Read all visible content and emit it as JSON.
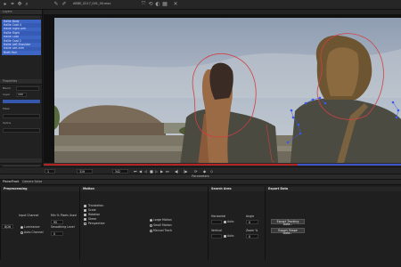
{
  "toolbar": {
    "title": "ABDE_0217_001_00.mov"
  },
  "left_panel": {
    "layers_header": "Layers",
    "layers": [
      "Hallie Body",
      "Hallie Coat 4",
      "Hallie Right Arm",
      "Hallie Right",
      "Hallie Coat",
      "Hallie Coat 2",
      "Hallie Left Shoulder",
      "Hallie Left Arm",
      "Brett Hair",
      "Hallie Hair"
    ],
    "properties_header": "Properties",
    "blend_label": "Blend",
    "opacity_value": "100",
    "layer_label": "Layer",
    "mask_label": "Mask",
    "spline_label": "Spline"
  },
  "timeline": {
    "current_frame": "319",
    "end_frame": "342",
    "start_frame": "1",
    "red_fraction": 0.71,
    "blue_start_fraction": 0.71,
    "blue_end_fraction": 1.0
  },
  "parameters_header": "Parameters",
  "bottom": {
    "tabs": [
      "PlanarTrack",
      "Camera Solve"
    ],
    "preprocessing": {
      "title": "Preprocessing",
      "input_channel_label": "Input Channel",
      "input_channel_value": "8/26",
      "luminance_label": "Luminance",
      "auto_channel_label": "Auto Channel",
      "min_pixels_label": "Min % Pixels Used",
      "min_pixels_value": "95",
      "smoothing_label": "Smoothing Level",
      "smoothing_value": "0"
    },
    "motion": {
      "title": "Motion",
      "options": [
        "Translation",
        "Scale",
        "Rotation",
        "Shear",
        "Perspective"
      ],
      "motion_types": [
        "Large Motion",
        "Small Motion",
        "Manual Track"
      ]
    },
    "search_area": {
      "title": "Search Area",
      "horizontal_label": "Horizontal",
      "vertical_label": "Vertical",
      "auto_label": "Auto",
      "angle_label": "Angle",
      "angle_value": "0",
      "zoom_label": "Zoom %",
      "zoom_value": "0"
    },
    "export": {
      "title": "Export Data",
      "tracking_button": "Export Tracking Data...",
      "shape_button": "Export Shape Data..."
    }
  }
}
